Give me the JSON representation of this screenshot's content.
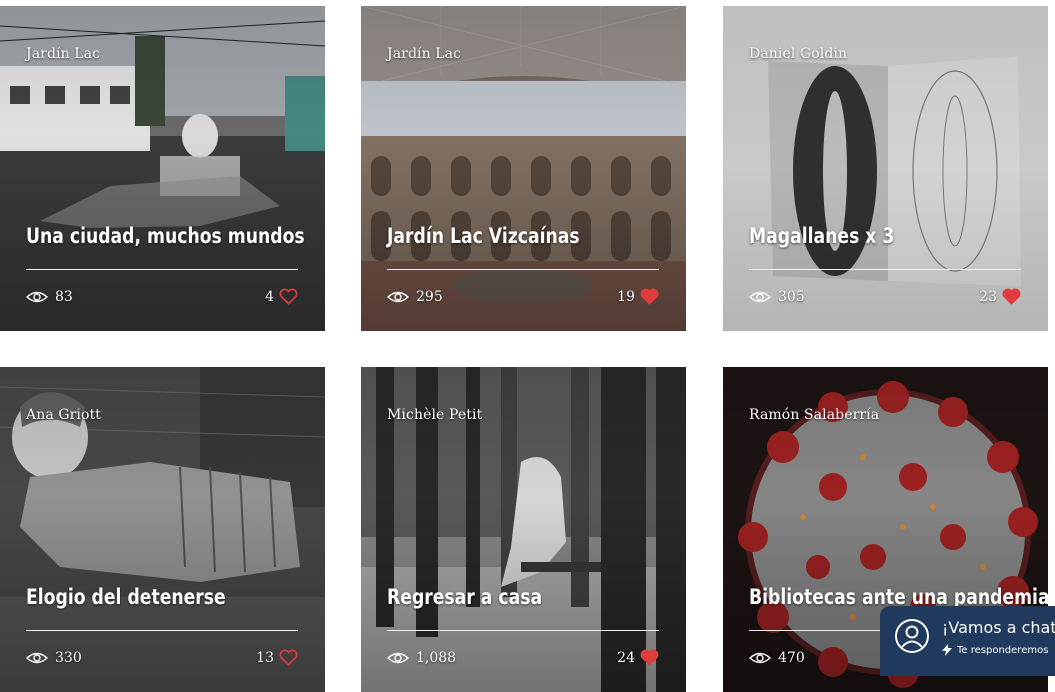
{
  "cards": [
    {
      "author": "Jardín Lac",
      "title": "Una ciudad, muchos mundos",
      "views": "83",
      "likes": "4",
      "liked": false
    },
    {
      "author": "Jardín Lac",
      "title": "Jardín Lac Vizcaínas",
      "views": "295",
      "likes": "19",
      "liked": true
    },
    {
      "author": "Daniel Goldin",
      "title": "Magallanes x 3",
      "views": "305",
      "likes": "23",
      "liked": true
    },
    {
      "author": "Ana Griott",
      "title": "Elogio del detenerse",
      "views": "330",
      "likes": "13",
      "liked": false
    },
    {
      "author": "Michèle Petit",
      "title": "Regresar a casa",
      "views": "1,088",
      "likes": "24",
      "liked": true
    },
    {
      "author": "Ramón Salaberría",
      "title": "Bibliotecas ante una pandemia",
      "views": "470",
      "likes": "",
      "liked": false
    }
  ],
  "chat": {
    "title": "¡Vamos a chat",
    "subtitle": "Te responderemos"
  },
  "icons": {
    "views": "eye-icon",
    "likes": "heart-icon",
    "chat": "user-avatar-icon",
    "reply": "lightning-icon"
  },
  "colors": {
    "heart": "#e03c3c",
    "chat_bg": "#1f3a5c"
  }
}
